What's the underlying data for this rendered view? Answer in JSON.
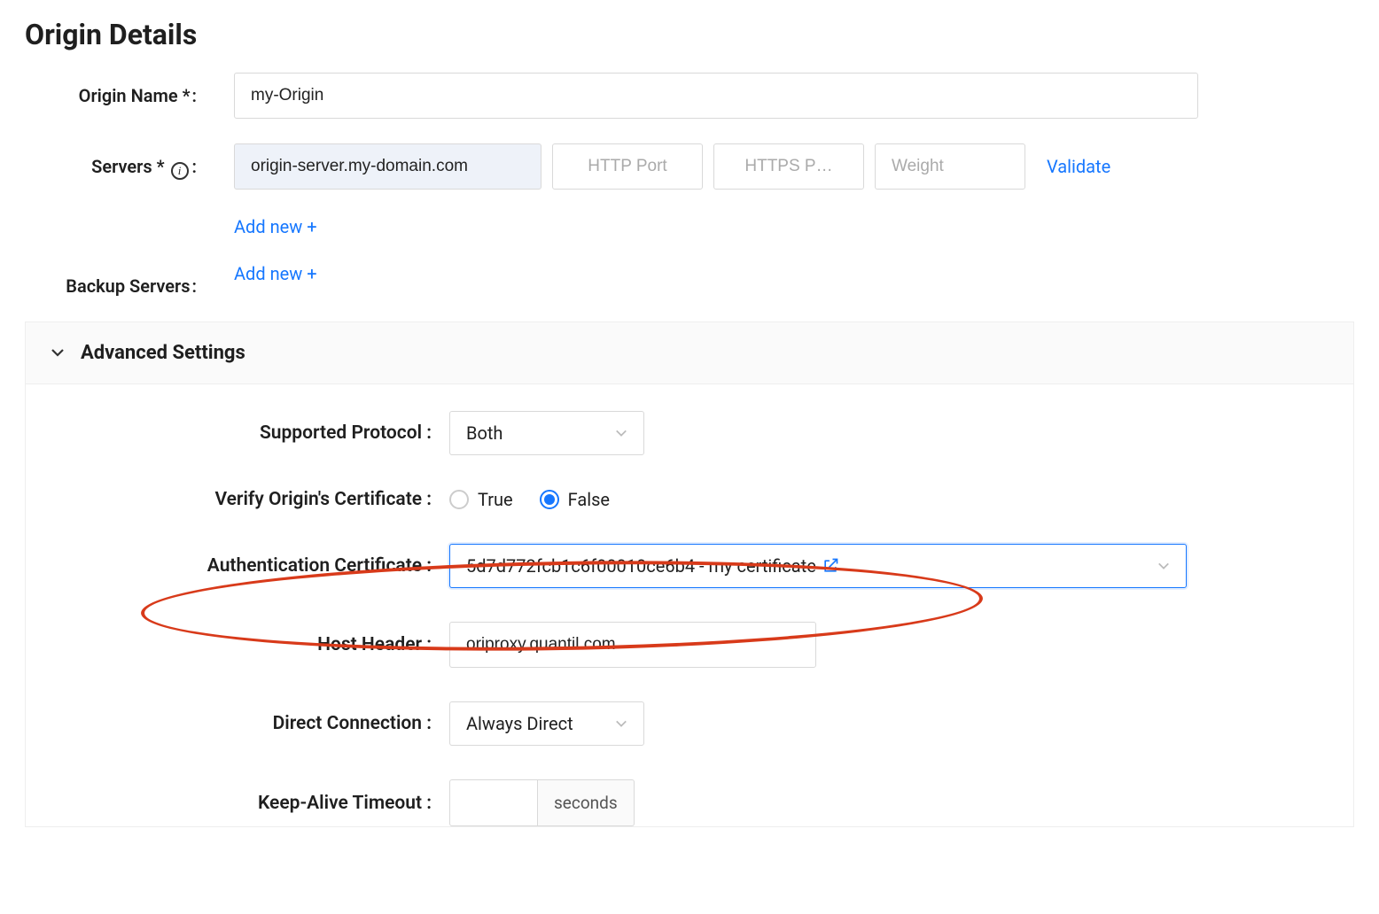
{
  "page": {
    "title": "Origin Details"
  },
  "fields": {
    "origin_name": {
      "label": "Origin Name *",
      "value": "my-Origin"
    },
    "servers": {
      "label": "Servers *",
      "server_value": "origin-server.my-domain.com",
      "http_port_placeholder": "HTTP Port",
      "https_port_placeholder": "HTTPS P…",
      "weight_placeholder": "Weight",
      "validate_label": "Validate",
      "add_new_label": "Add new +"
    },
    "backup_servers": {
      "label": "Backup Servers",
      "add_new_label": "Add new +"
    }
  },
  "advanced": {
    "header": "Advanced Settings",
    "supported_protocol": {
      "label": "Supported Protocol",
      "value": "Both"
    },
    "verify_cert": {
      "label": "Verify Origin's Certificate",
      "true_label": "True",
      "false_label": "False",
      "selected": "false"
    },
    "auth_cert": {
      "label": "Authentication Certificate",
      "value": "5d7d772fcb1c6f00010ce6b4 - my certificate"
    },
    "host_header": {
      "label": "Host Header",
      "value": "oriproxy.quantil.com"
    },
    "direct_connection": {
      "label": "Direct Connection",
      "value": "Always Direct"
    },
    "keep_alive": {
      "label": "Keep-Alive Timeout",
      "suffix": "seconds"
    }
  }
}
